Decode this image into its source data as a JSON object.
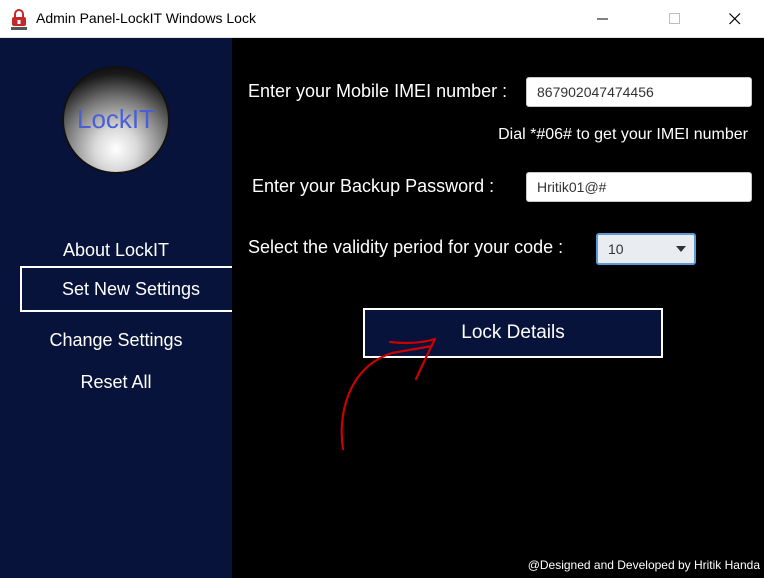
{
  "window": {
    "title": "Admin Panel-LockIT Windows Lock"
  },
  "sidebar": {
    "logo_text": "LockIT",
    "items": [
      {
        "label": "About LockIT",
        "active": false
      },
      {
        "label": "Set New Settings",
        "active": true
      },
      {
        "label": "Change Settings",
        "active": false
      },
      {
        "label": "Reset All",
        "active": false
      }
    ]
  },
  "form": {
    "imei_label": "Enter your Mobile IMEI number :",
    "imei_value": "867902047474456",
    "imei_hint": "Dial *#06# to get your IMEI number",
    "password_label": "Enter your Backup Password :",
    "password_value": "Hritik01@#",
    "validity_label": "Select the validity period for your code :",
    "validity_selected": "10",
    "submit_label": "Lock Details"
  },
  "footer": {
    "credit": "@Designed and Developed by Hritik Handa"
  },
  "colors": {
    "sidebar_bg": "#07133a",
    "main_bg": "#000000",
    "logo_text": "#4a5fd6",
    "annotation_arrow": "#cc0000",
    "select_focus": "#5b9bd5"
  },
  "icons": {
    "app": "lock-icon",
    "minimize": "minimize-icon",
    "maximize": "maximize-icon",
    "close": "close-icon",
    "dropdown": "chevron-down-icon"
  }
}
